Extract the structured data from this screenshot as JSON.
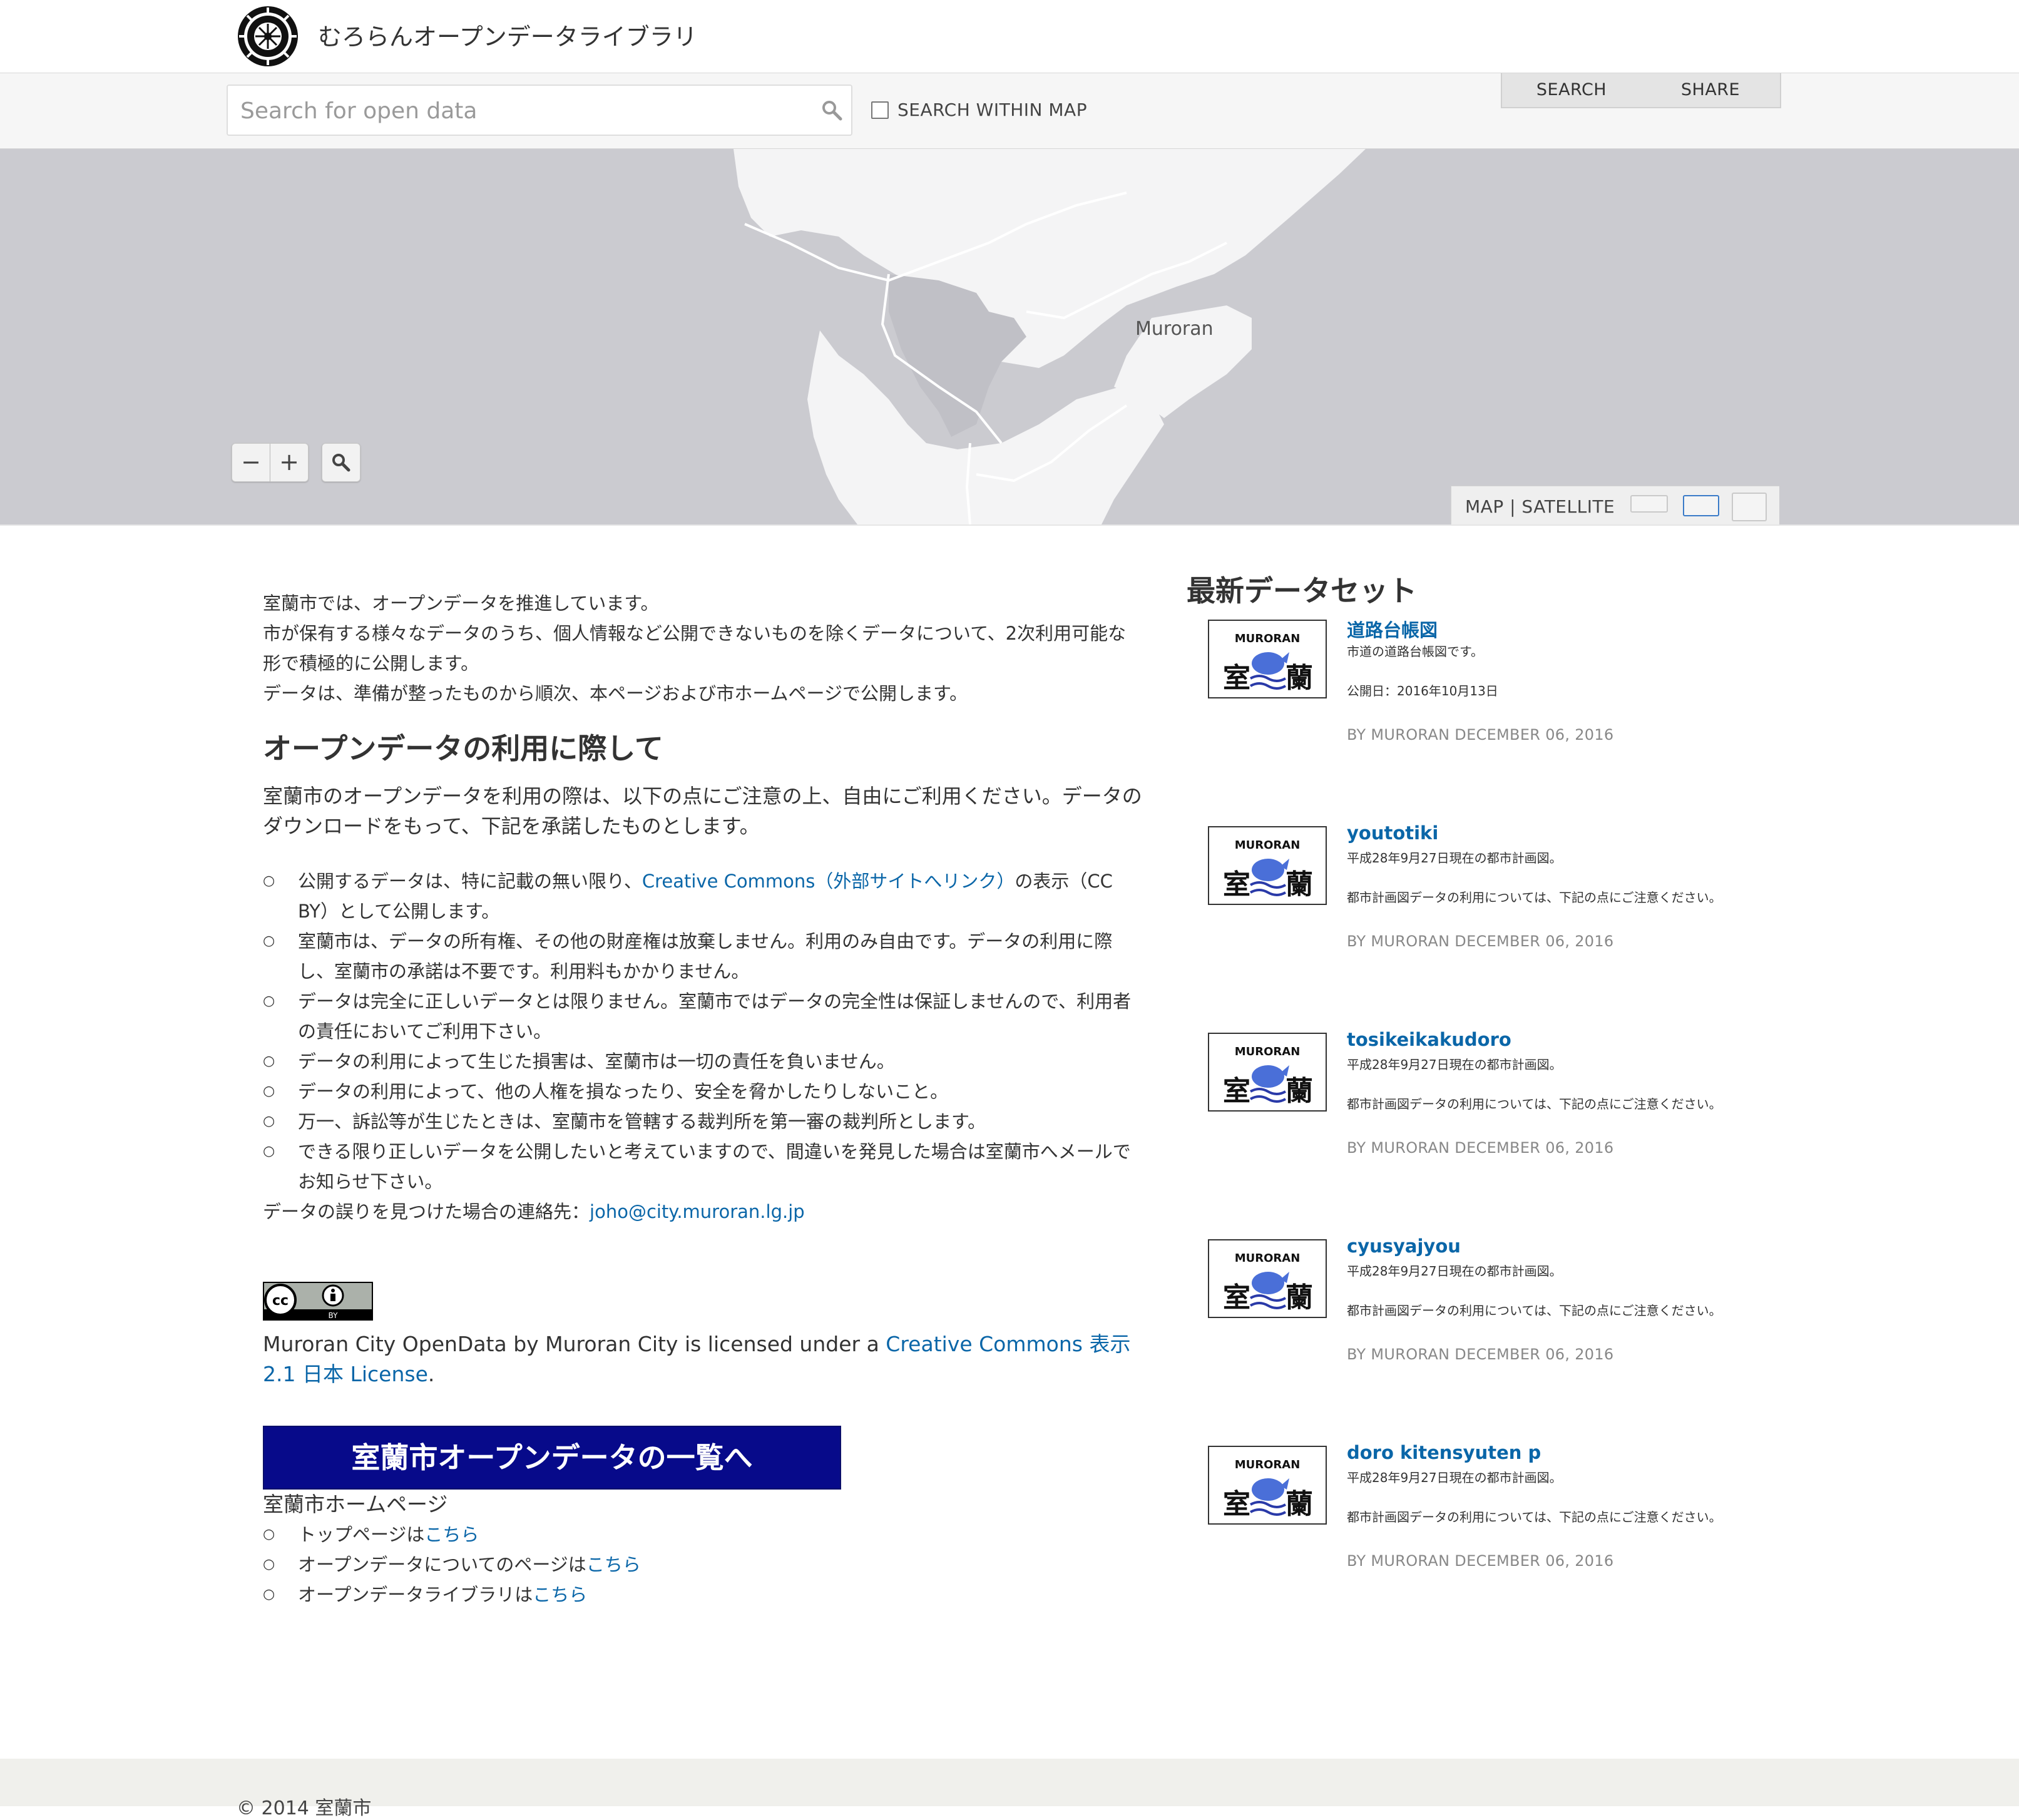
{
  "header": {
    "site_title": "むろらんオープンデータライブラリ"
  },
  "search": {
    "placeholder": "Search for open data",
    "within_map_label": "SEARCH WITHIN MAP",
    "tab_search": "SEARCH",
    "tab_share": "SHARE"
  },
  "map": {
    "city_label": "Muroran",
    "zoom_out": "−",
    "zoom_in": "+",
    "type_label": "MAP | SATELLITE"
  },
  "intro": {
    "line1": "室蘭市では、オープンデータを推進しています。",
    "line2": "市が保有する様々なデータのうち、個人情報など公開できないものを除くデータについて、2次利用可能な形で積極的に公開します。",
    "line3": "データは、準備が整ったものから順次、本ページおよび市ホームページで公開します。"
  },
  "usage": {
    "heading": "オープンデータの利用に際して",
    "lead": "室蘭市のオープンデータを利用の際は、以下の点にご注意の上、自由にご利用ください。データのダウンロードをもって、下記を承諾したものとします。",
    "rule1_pre": "公開するデータは、特に記載の無い限り、",
    "rule1_link": "Creative Commons（外部サイトへリンク）",
    "rule1_post": "の表示（CC BY）として公開します。",
    "rule2": "室蘭市は、データの所有権、その他の財産権は放棄しません。利用のみ自由です。データの利用に際し、室蘭市の承諾は不要です。利用料もかかりません。",
    "rule3": "データは完全に正しいデータとは限りません。室蘭市ではデータの完全性は保証しませんので、利用者の責任においてご利用下さい。",
    "rule4": "データの利用によって生じた損害は、室蘭市は一切の責任を負いません。",
    "rule5": "データの利用によって、他の人権を損なったり、安全を脅かしたりしないこと。",
    "rule6": "万一、訴訟等が生じたときは、室蘭市を管轄する裁判所を第一審の裁判所とします。",
    "rule7": "できる限り正しいデータを公開したいと考えていますので、間違いを発見した場合は室蘭市へメールでお知らせ下さい。",
    "contact_label": "データの誤りを見つけた場合の連絡先：",
    "contact_email": "joho@city.muroran.lg.jp"
  },
  "license": {
    "badge_cc": "cc",
    "badge_by": "BY",
    "text_pre": "Muroran City OpenData by Muroran City is licensed under a ",
    "link": "Creative Commons 表示 2.1 日本 License",
    "text_post": "."
  },
  "cta": {
    "label": "室蘭市オープンデータの一覧へ"
  },
  "homepage": {
    "title": "室蘭市ホームページ",
    "item1_pre": "トップページは",
    "item2_pre": "オープンデータについてのページは",
    "item3_pre": "オープンデータライブラリは",
    "link_text": "こちら"
  },
  "sidebar": {
    "title": "最新データセット",
    "thumb_text_top": "MURORAN",
    "thumb_text_left": "室",
    "thumb_text_right": "蘭",
    "datasets": [
      {
        "title": "道路台帳図",
        "desc": "市道の道路台帳図です。",
        "desc2": "公開日：2016年10月13日",
        "by": "BY MURORAN DECEMBER 06, 2016"
      },
      {
        "title": "youtotiki",
        "desc": "平成28年9月27日現在の都市計画図。",
        "desc2": "都市計画図データの利用については、下記の点にご注意ください。",
        "by": "BY MURORAN DECEMBER 06, 2016"
      },
      {
        "title": "tosikeikakudoro",
        "desc": "平成28年9月27日現在の都市計画図。",
        "desc2": "都市計画図データの利用については、下記の点にご注意ください。",
        "by": "BY MURORAN DECEMBER 06, 2016"
      },
      {
        "title": "cyusyajyou",
        "desc": "平成28年9月27日現在の都市計画図。",
        "desc2": "都市計画図データの利用については、下記の点にご注意ください。",
        "by": "BY MURORAN DECEMBER 06, 2016"
      },
      {
        "title": "doro kitensyuten p",
        "desc": "平成28年9月27日現在の都市計画図。",
        "desc2": "都市計画図データの利用については、下記の点にご注意ください。",
        "by": "BY MURORAN DECEMBER 06, 2016"
      }
    ]
  },
  "footer": {
    "copyright": "© 2014 室蘭市"
  }
}
